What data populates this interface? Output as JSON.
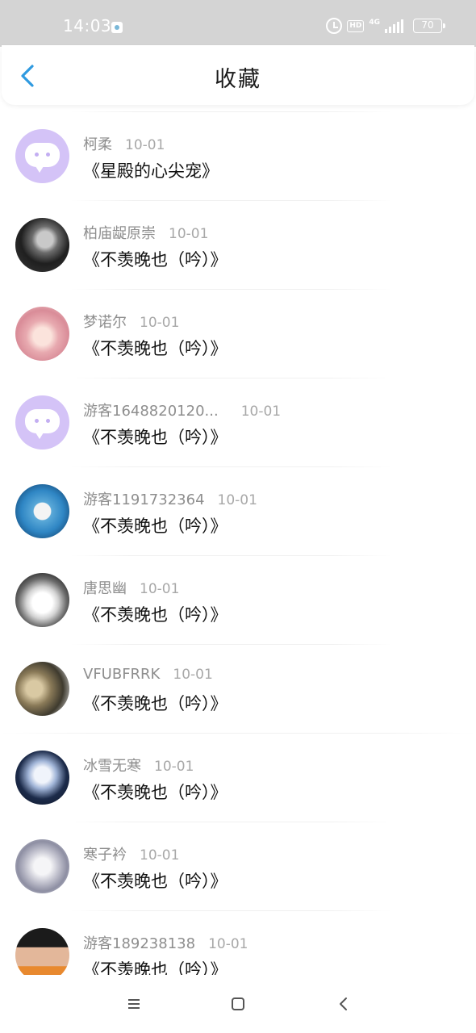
{
  "status_bar": {
    "time": "14:03",
    "hd": "HD",
    "network": "4G",
    "battery": "70"
  },
  "header": {
    "title": "收藏",
    "back_icon": "chevron-left-icon",
    "accent_color": "#2f9ae0"
  },
  "favorites": [
    {
      "user": "柯柔",
      "date": "10-01",
      "book": "《星殿的心尖宠》",
      "avatar": "default"
    },
    {
      "user": "柏庙龊原崇",
      "date": "10-01",
      "book": "《不羡晚也（吟）》",
      "avatar": "photo"
    },
    {
      "user": "梦诺尔",
      "date": "10-01",
      "book": "《不羡晚也（吟）》",
      "avatar": "photo"
    },
    {
      "user": "游客1648820120...",
      "date": "10-01",
      "book": "《不羡晚也（吟）》",
      "avatar": "default"
    },
    {
      "user": "游客1191732364",
      "date": "10-01",
      "book": "《不羡晚也（吟）》",
      "avatar": "photo"
    },
    {
      "user": "唐思幽",
      "date": "10-01",
      "book": "《不羡晚也（吟）》",
      "avatar": "photo"
    },
    {
      "user": "VFUBFRRK",
      "date": "10-01",
      "book": "《不羡晚也（吟）》",
      "avatar": "photo"
    },
    {
      "user": "冰雪无寒",
      "date": "10-01",
      "book": "《不羡晚也（吟）》",
      "avatar": "photo"
    },
    {
      "user": "寒子衿",
      "date": "10-01",
      "book": "《不羡晚也（吟）》",
      "avatar": "photo"
    },
    {
      "user": "游客189238138",
      "date": "10-01",
      "book": "《不羡晚也（吟）》",
      "avatar": "photo"
    }
  ],
  "nav_bar": {
    "menu_icon": "menu-icon",
    "home_icon": "home-square-icon",
    "back_icon": "back-triangle-icon"
  }
}
